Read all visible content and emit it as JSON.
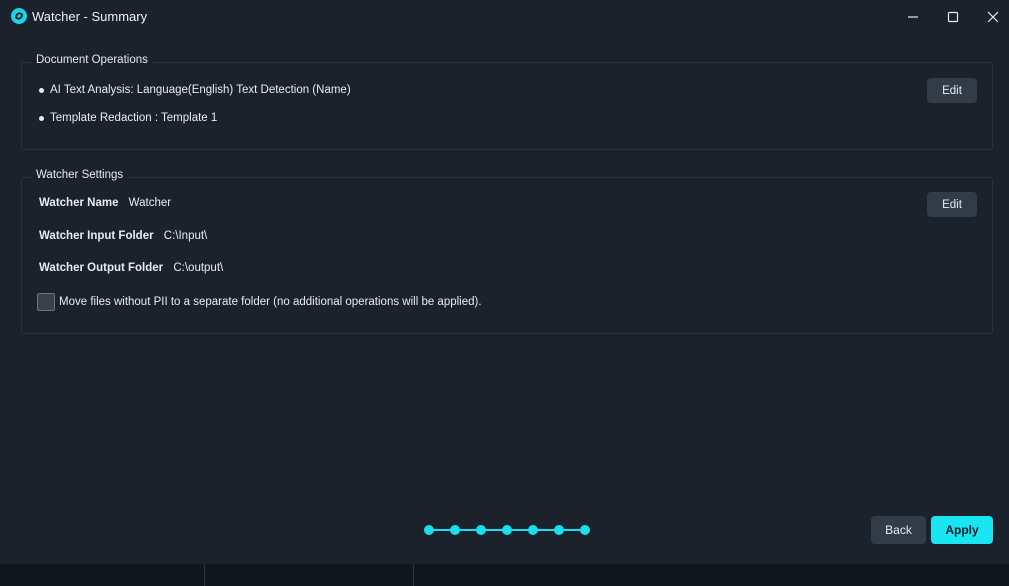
{
  "window": {
    "title": "Watcher - Summary",
    "icon": "watcher-app-icon",
    "controls": [
      "minimize-icon",
      "maximize-icon",
      "close-icon"
    ]
  },
  "document_operations": {
    "title": "Document Operations",
    "items": [
      "AI Text Analysis: Language(English) Text Detection (Name)",
      "Template Redaction : Template 1"
    ],
    "edit_label": "Edit"
  },
  "watcher_settings": {
    "title": "Watcher Settings",
    "edit_label": "Edit",
    "fields": [
      {
        "key": "Watcher Name",
        "value": "Watcher"
      },
      {
        "key": "Watcher Input Folder",
        "value": "C:\\Input\\"
      },
      {
        "key": "Watcher Output Folder",
        "value": "C:\\output\\"
      }
    ],
    "move_files_label": "Move files without PII to a separate folder (no additional operations will be applied).",
    "move_files_checked": false
  },
  "stepper": {
    "total_steps": 7,
    "completed_steps": 7
  },
  "footer": {
    "back_label": "Back",
    "apply_label": "Apply"
  },
  "colors": {
    "background": "#1b222c",
    "accent": "#19e6f2",
    "button": "#323b48"
  }
}
